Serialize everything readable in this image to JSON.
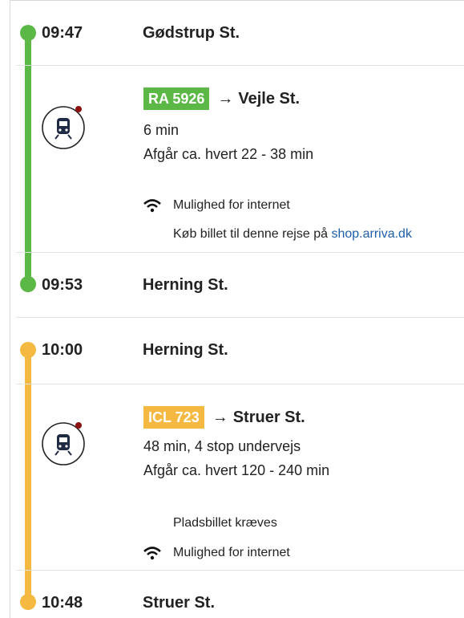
{
  "colors": {
    "leg1": "#5bb846",
    "leg2": "#f5b942",
    "link": "#1d5fa8",
    "notify_dot": "#8b1010"
  },
  "legs": [
    {
      "departure": {
        "time": "09:47",
        "station": "Gødstrup St."
      },
      "line": "RA 5926",
      "arrow": "→",
      "destination": "Vejle St.",
      "duration": "6 min",
      "frequency": "Afgår ca. hvert 22 - 38 min",
      "internet": "Mulighed for internet",
      "ticket_text": "Køb billet til denne rejse på",
      "ticket_link": "shop.arriva.dk",
      "arrival": {
        "time": "09:53",
        "station": "Herning St."
      }
    },
    {
      "departure": {
        "time": "10:00",
        "station": "Herning St."
      },
      "line": "ICL 723",
      "arrow": "→",
      "destination": "Struer St.",
      "duration": "48 min, 4 stop undervejs",
      "frequency": "Afgår ca. hvert 120 - 240 min",
      "seat_reservation": "Pladsbillet kræves",
      "internet": "Mulighed for internet",
      "arrival": {
        "time": "10:48",
        "station": "Struer St."
      }
    }
  ]
}
